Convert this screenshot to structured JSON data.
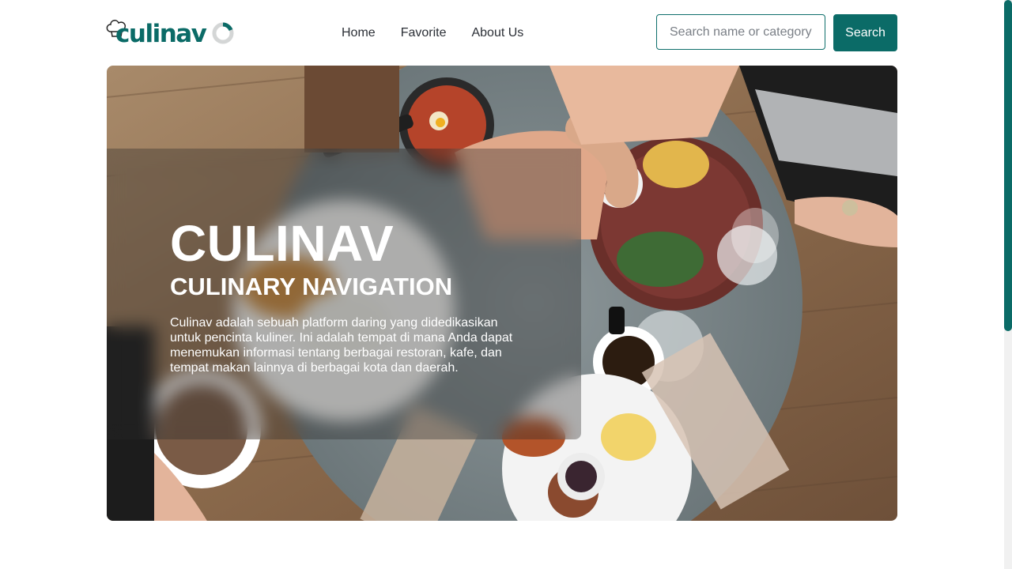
{
  "brand": {
    "name": "culinav"
  },
  "nav": {
    "items": [
      {
        "label": "Home"
      },
      {
        "label": "Favorite"
      },
      {
        "label": "About Us"
      }
    ]
  },
  "search": {
    "placeholder": "Search name or category of restaurant",
    "value": "",
    "button_label": "Search"
  },
  "hero": {
    "title": "CULINAV",
    "subtitle": "CULINARY NAVIGATION",
    "description": "Culinav adalah sebuah platform daring yang didedikasikan untuk pencinta kuliner. Ini adalah tempat di mana Anda dapat menemukan informasi tentang berbagai restoran, kafe, dan tempat makan lainnya di berbagai kota dan daerah."
  },
  "colors": {
    "brand": "#0b6b67",
    "text": "#2b2f36",
    "background": "#ffffff"
  },
  "icons": {
    "logo_hat": "chef-hat-icon",
    "logo_ring": "ring-icon"
  }
}
